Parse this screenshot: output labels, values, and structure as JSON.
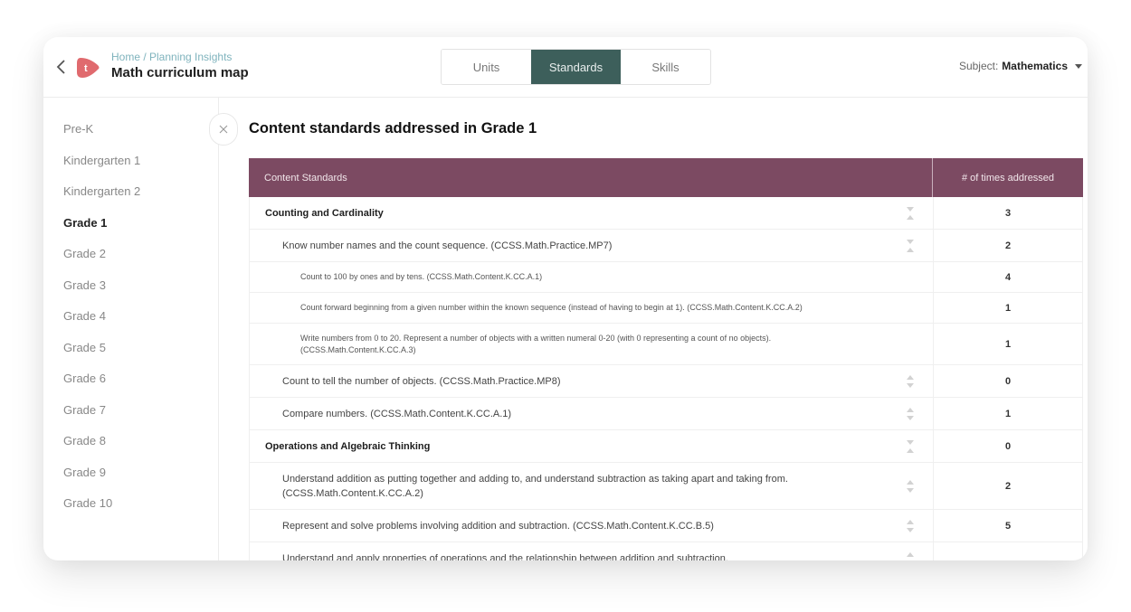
{
  "header": {
    "breadcrumb": "Home / Planning Insights",
    "title": "Math curriculum map",
    "logo_letter": "t",
    "tabs": [
      {
        "label": "Units",
        "active": false
      },
      {
        "label": "Standards",
        "active": true
      },
      {
        "label": "Skills",
        "active": false
      }
    ],
    "subject_label": "Subject:",
    "subject_value": "Mathematics"
  },
  "sidebar": {
    "items": [
      {
        "label": "Pre-K",
        "active": false
      },
      {
        "label": "Kindergarten 1",
        "active": false
      },
      {
        "label": "Kindergarten 2",
        "active": false
      },
      {
        "label": "Grade 1",
        "active": true
      },
      {
        "label": "Grade 2",
        "active": false
      },
      {
        "label": "Grade 3",
        "active": false
      },
      {
        "label": "Grade 4",
        "active": false
      },
      {
        "label": "Grade 5",
        "active": false
      },
      {
        "label": "Grade 6",
        "active": false
      },
      {
        "label": "Grade 7",
        "active": false
      },
      {
        "label": "Grade 8",
        "active": false
      },
      {
        "label": "Grade 9",
        "active": false
      },
      {
        "label": "Grade 10",
        "active": false
      }
    ]
  },
  "main": {
    "heading": "Content standards addressed in Grade 1",
    "columns": [
      "Content Standards",
      "# of times addressed"
    ],
    "rows": [
      {
        "level": 0,
        "text": "Counting and Cardinality",
        "count": "3",
        "toggle": "collapse"
      },
      {
        "level": 1,
        "text": "Know number names and the count sequence. (CCSS.Math.Practice.MP7)",
        "count": "2",
        "toggle": "collapse"
      },
      {
        "level": 2,
        "text": "Count to 100 by ones and by tens. (CCSS.Math.Content.K.CC.A.1)",
        "count": "4",
        "toggle": "none"
      },
      {
        "level": 2,
        "text": "Count forward beginning from a given number within the known sequence (instead of having to begin at 1). (CCSS.Math.Content.K.CC.A.2)",
        "count": "1",
        "toggle": "none"
      },
      {
        "level": 2,
        "text": "Write numbers from 0 to 20. Represent a number of objects with a written numeral 0-20 (with 0 representing a count of no objects). (CCSS.Math.Content.K.CC.A.3)",
        "count": "1",
        "toggle": "none"
      },
      {
        "level": 1,
        "text": "Count to tell the number of objects. (CCSS.Math.Practice.MP8)",
        "count": "0",
        "toggle": "expand"
      },
      {
        "level": 1,
        "text": "Compare numbers. (CCSS.Math.Content.K.CC.A.1)",
        "count": "1",
        "toggle": "expand"
      },
      {
        "level": 0,
        "text": "Operations and Algebraic Thinking",
        "count": "0",
        "toggle": "collapse"
      },
      {
        "level": 1,
        "text": "Understand addition as putting together and adding to, and understand subtraction as taking apart and taking from. (CCSS.Math.Content.K.CC.A.2)",
        "count": "2",
        "toggle": "expand"
      },
      {
        "level": 1,
        "text": "Represent and solve problems involving addition and subtraction. (CCSS.Math.Content.K.CC.B.5)",
        "count": "5",
        "toggle": "expand"
      },
      {
        "level": 1,
        "text": "Understand and apply properties of operations and the relationship between addition and subtraction.",
        "count": "",
        "toggle": "expand"
      }
    ]
  },
  "colors": {
    "accent_tab": "#3d5f5b",
    "table_header": "#7c4a62",
    "logo": "#e06a6e",
    "breadcrumb": "#7fb3bd"
  }
}
